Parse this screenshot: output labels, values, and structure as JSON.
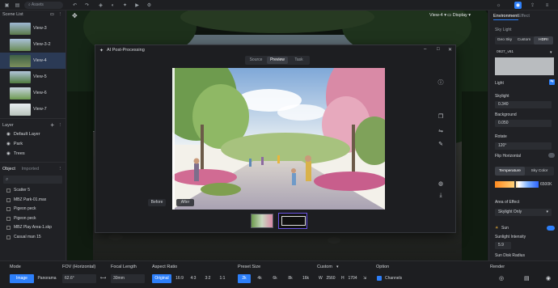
{
  "topbar": {
    "search_placeholder": "Assets",
    "view_label": "View-4",
    "display_label": "Display"
  },
  "scene_list": {
    "title": "Scene List",
    "items": [
      {
        "label": "View-3"
      },
      {
        "label": "View-3-2"
      },
      {
        "label": "View-4"
      },
      {
        "label": "View-5"
      },
      {
        "label": "View-6"
      },
      {
        "label": "View-7"
      }
    ]
  },
  "layers": {
    "title": "Layer",
    "items": [
      {
        "label": "Default Layer"
      },
      {
        "label": "Park"
      },
      {
        "label": "Trees"
      }
    ]
  },
  "objects": {
    "tab_object": "Object",
    "tab_imported": "Imported",
    "items": [
      {
        "label": "Scatter 5"
      },
      {
        "label": "MBZ Park-01.max"
      },
      {
        "label": "Pigeon peck"
      },
      {
        "label": "Pigeon peck"
      },
      {
        "label": "MBZ Play Area-1.skp"
      },
      {
        "label": "Casual man 15"
      }
    ]
  },
  "dialog": {
    "title": "AI Post-Processing",
    "tabs": [
      "Source",
      "Preview",
      "Task"
    ],
    "active_tab": "Preview",
    "before_label": "Before",
    "after_label": "After"
  },
  "environment": {
    "tab_environment": "Environment",
    "tab_effect": "Effect",
    "sky_light_label": "Sky Light",
    "sky_buttons": [
      "Geo Sky",
      "Custom",
      "HDRI"
    ],
    "hdri_name": "0927_v51",
    "light_label": "Light",
    "skylight_label": "Skylight",
    "skylight_value": "0.340",
    "background_label": "Background",
    "background_value": "0.050",
    "rotate_label": "Rotate",
    "rotate_value": "120°",
    "flip_label": "Flip Horizontal",
    "temp_tab": "Temperature",
    "sky_color_tab": "Sky Color",
    "temp_value": "6500K",
    "area_label": "Area of Effect",
    "area_value": "Skylight Only",
    "sun_label": "Sun",
    "sunlight_label": "Sunlight Intensity",
    "sunlight_value": "5.9",
    "sun_disk_label": "Sun Disk Radius"
  },
  "bottom": {
    "mode_label": "Mode",
    "mode_image": "Image",
    "mode_panorama": "Panorama",
    "fov_label": "FOV (Horizontal)",
    "fov_value": "62.6°",
    "focal_label": "Focal Length",
    "focal_value": "30mm",
    "aspect_label": "Aspect Ratio",
    "aspect_options": [
      "Original",
      "16:9",
      "4:3",
      "3:2",
      "1:1"
    ],
    "preset_label": "Preset Size",
    "preset_options": [
      "2k",
      "4k",
      "6k",
      "8k",
      "16k"
    ],
    "custom_label": "Custom",
    "w_label": "W",
    "w_value": "2560",
    "h_label": "H",
    "h_value": "1704",
    "option_label": "Option",
    "channels_label": "Channels",
    "render_label": "Render"
  }
}
